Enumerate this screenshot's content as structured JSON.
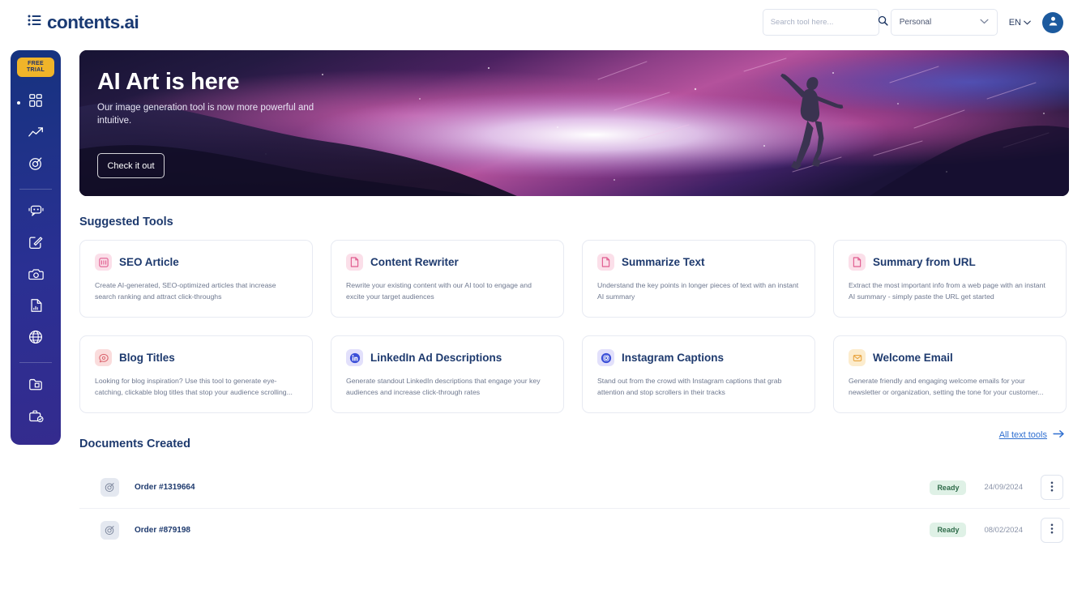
{
  "header": {
    "logo_text": "contents.ai",
    "logo_icon": "list-icon",
    "search": {
      "placeholder": "Search tool here...",
      "value": "",
      "icon": "search-icon"
    },
    "workspace_select": {
      "value": "Personal",
      "icon": "chevron-down-icon"
    },
    "language": {
      "value": "EN",
      "icon": "chevron-down-icon"
    },
    "avatar": {
      "icon": "user-avatar-icon"
    }
  },
  "sidebar": {
    "trial_badge": {
      "line1": "FREE",
      "line2": "TRIAL",
      "color": "#f0b429"
    },
    "items": [
      {
        "name": "dashboard",
        "icon": "grid-dashboard-icon",
        "active": true
      },
      {
        "name": "analytics",
        "icon": "trending-up-icon",
        "active": false
      },
      {
        "name": "targets",
        "icon": "target-icon",
        "active": false
      },
      {
        "name": "chatbot",
        "icon": "chat-bot-icon",
        "active": false
      },
      {
        "name": "editor",
        "icon": "edit-square-icon",
        "active": false
      },
      {
        "name": "images",
        "icon": "camera-icon",
        "active": false
      },
      {
        "name": "audio-document",
        "icon": "document-audio-icon",
        "active": false
      },
      {
        "name": "web",
        "icon": "globe-icon",
        "active": false
      },
      {
        "name": "projects",
        "icon": "folder-icon",
        "active": false
      },
      {
        "name": "tasks",
        "icon": "briefcase-check-icon",
        "active": false
      }
    ]
  },
  "hero": {
    "title": "AI Art is here",
    "subtitle": "Our image generation tool is now more powerful and intuitive.",
    "button_label": "Check it out"
  },
  "suggested": {
    "heading": "Suggested Tools",
    "tools": [
      {
        "title": "SEO Article",
        "description": "Create AI-generated, SEO-optimized articles that increase search ranking and attract click-throughs",
        "icon": "seo-article-icon",
        "icon_bg": "#fbdfe9",
        "icon_fg": "#e05c8f"
      },
      {
        "title": "Content Rewriter",
        "description": "Rewrite your existing content with our AI tool to engage and excite your target audiences",
        "icon": "document-rewrite-icon",
        "icon_bg": "#fbdfe9",
        "icon_fg": "#e05c8f"
      },
      {
        "title": "Summarize Text",
        "description": "Understand the key points in longer pieces of text with an instant AI summary",
        "icon": "document-summary-icon",
        "icon_bg": "#fbdfe9",
        "icon_fg": "#e05c8f"
      },
      {
        "title": "Summary from URL",
        "description": "Extract the most important info from a web page with an instant AI summary - simply paste the URL get started",
        "icon": "document-link-icon",
        "icon_bg": "#fbdfe9",
        "icon_fg": "#e05c8f"
      },
      {
        "title": "Blog Titles",
        "description": "Looking for blog inspiration? Use this tool to generate eye-catching, clickable blog titles that stop your audience scrolling...",
        "icon": "chat-bubble-icon",
        "icon_bg": "#fadcdc",
        "icon_fg": "#d9606a"
      },
      {
        "title": "LinkedIn Ad Descriptions",
        "description": "Generate standout LinkedIn descriptions that engage your key audiences and increase click-through rates",
        "icon": "linkedin-icon",
        "icon_bg": "#e2e0fb",
        "icon_fg": "#3b4fd8"
      },
      {
        "title": "Instagram Captions",
        "description": "Stand out from the crowd with Instagram captions that grab attention and stop scrollers in their tracks",
        "icon": "instagram-icon",
        "icon_bg": "#e2e0fb",
        "icon_fg": "#3b4fd8"
      },
      {
        "title": "Welcome Email",
        "description": "Generate friendly and engaging welcome emails for your newsletter or organization, setting the tone for your customer...",
        "icon": "mail-icon",
        "icon_bg": "#fceccd",
        "icon_fg": "#e8a33d"
      }
    ],
    "all_tools_label": "All text tools",
    "all_tools_icon": "arrow-right-icon"
  },
  "documents": {
    "heading": "Documents Created",
    "rows": [
      {
        "icon": "target-icon",
        "name": "Order #1319664",
        "status": "Ready",
        "date": "24/09/2024",
        "menu_icon": "kebab-menu-icon"
      },
      {
        "icon": "target-icon",
        "name": "Order #879198",
        "status": "Ready",
        "date": "08/02/2024",
        "menu_icon": "kebab-menu-icon"
      }
    ]
  },
  "colors": {
    "brand_navy": "#1e3a6e",
    "sidebar_start": "#16337f",
    "sidebar_end": "#342b8e",
    "link_blue": "#2f6fd0",
    "status_green_bg": "#dff1e6",
    "status_green_fg": "#2f6b4a",
    "trial_amber": "#f0b429"
  }
}
